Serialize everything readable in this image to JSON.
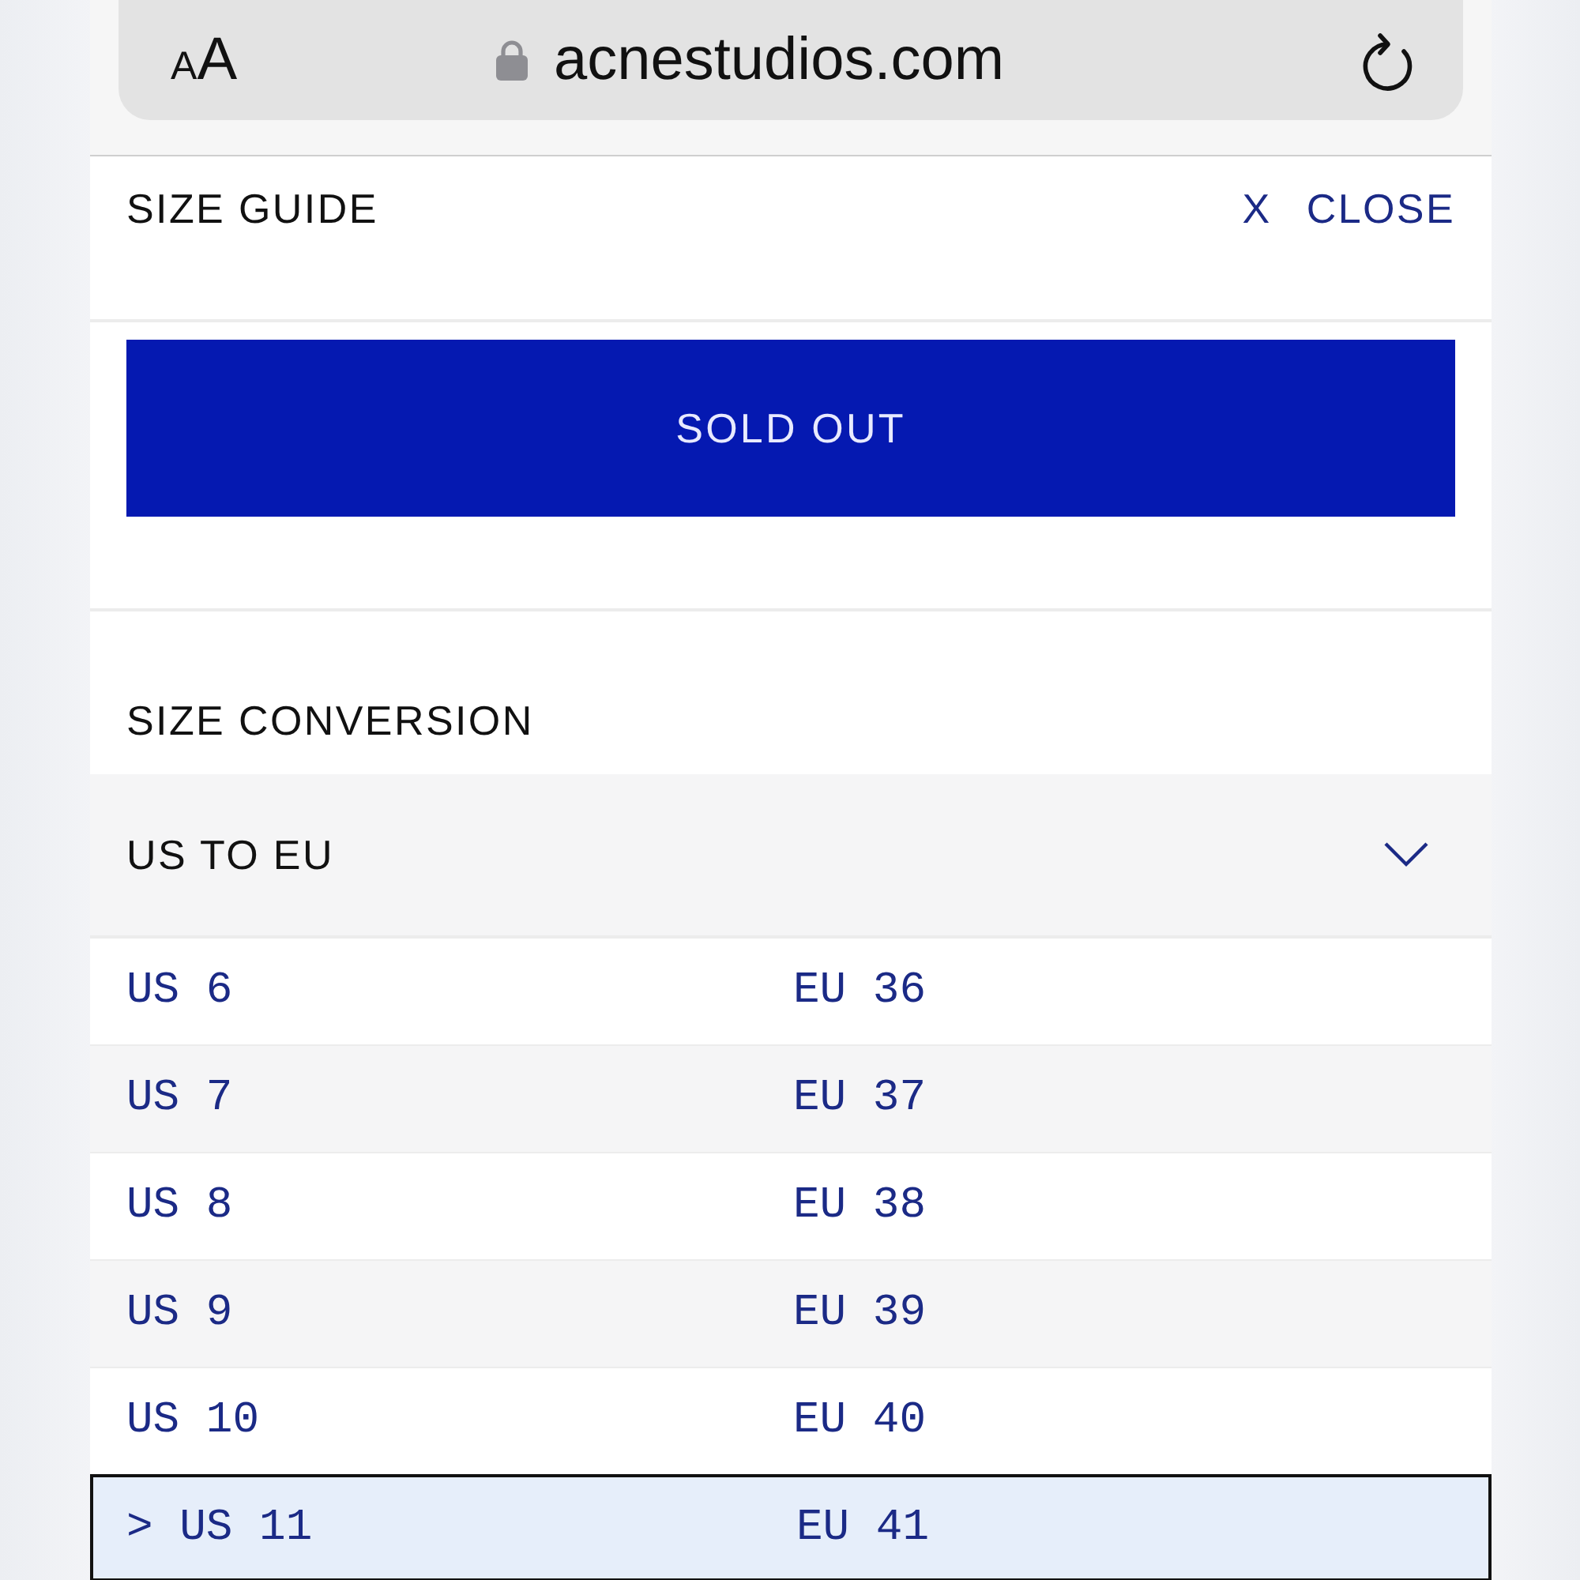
{
  "browser_bar": {
    "text_size_button": "AA",
    "url": "acnestudios.com"
  },
  "size_guide": {
    "title": "SIZE GUIDE",
    "close_icon": "X",
    "close_label": "CLOSE"
  },
  "sold_out_button": {
    "label": "SOLD OUT",
    "disabled": true
  },
  "size_conversion": {
    "title": "SIZE CONVERSION",
    "dropdown": {
      "value": "US TO EU",
      "expanded": false
    },
    "rows": [
      {
        "us": "US 6",
        "eu": "EU 36",
        "selected": false
      },
      {
        "us": "US 7",
        "eu": "EU 37",
        "selected": false
      },
      {
        "us": "US 8",
        "eu": "EU 38",
        "selected": false
      },
      {
        "us": "US 9",
        "eu": "EU 39",
        "selected": false
      },
      {
        "us": "US 10",
        "eu": "EU 40",
        "selected": false
      },
      {
        "marker": ">",
        "us": "US 11",
        "eu": "EU 41",
        "selected": true
      }
    ]
  }
}
